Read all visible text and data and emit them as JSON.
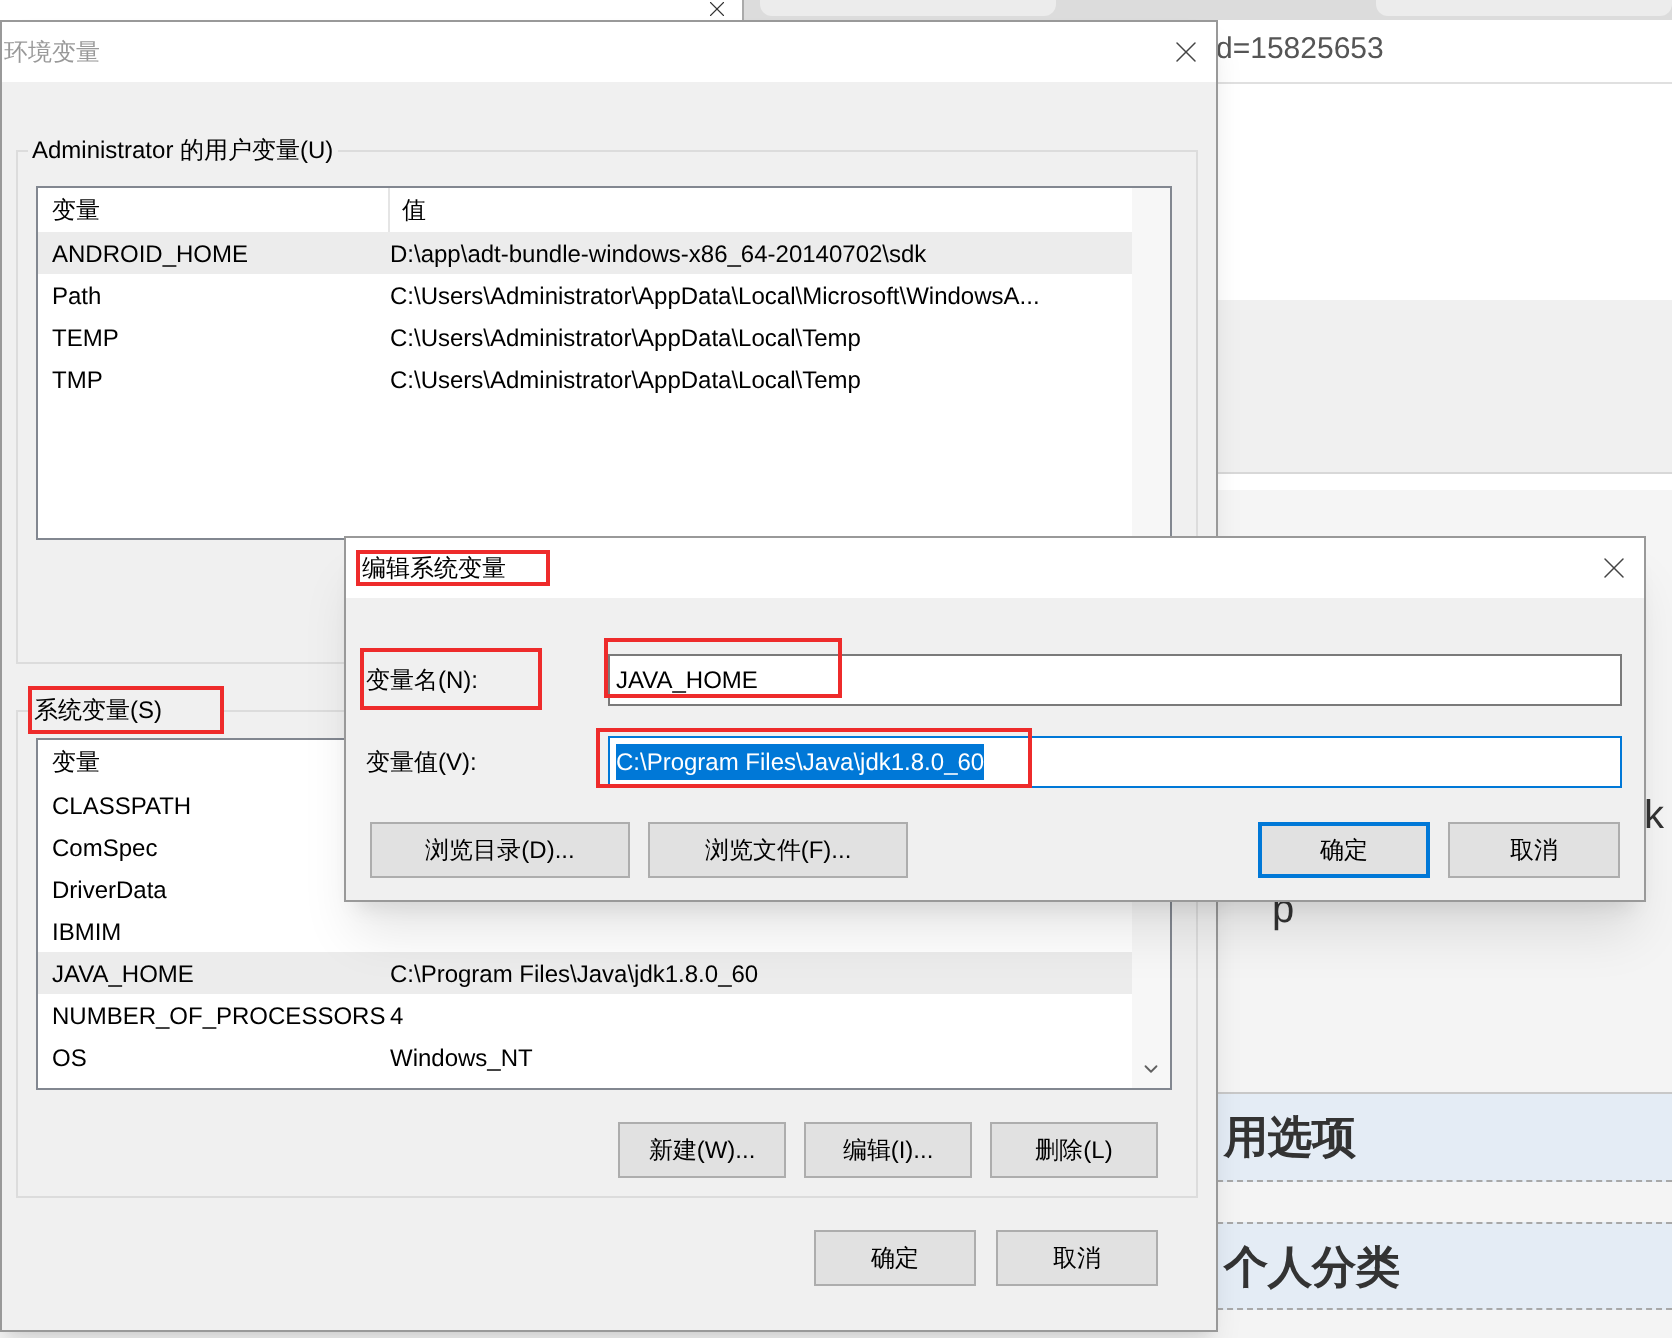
{
  "browser": {
    "address_fragment": "d=15825653",
    "fragment_1": "k",
    "fragment_2": "p",
    "sections": [
      "用选项",
      "个人分类"
    ]
  },
  "env_dialog": {
    "title": "环境变量",
    "user_group": {
      "title": "Administrator 的用户变量(U)",
      "columns": [
        "变量",
        "值"
      ],
      "rows": [
        {
          "name": "ANDROID_HOME",
          "value": "D:\\app\\adt-bundle-windows-x86_64-20140702\\sdk",
          "selected": true
        },
        {
          "name": "Path",
          "value": "C:\\Users\\Administrator\\AppData\\Local\\Microsoft\\WindowsA...",
          "selected": false
        },
        {
          "name": "TEMP",
          "value": "C:\\Users\\Administrator\\AppData\\Local\\Temp",
          "selected": false
        },
        {
          "name": "TMP",
          "value": "C:\\Users\\Administrator\\AppData\\Local\\Temp",
          "selected": false
        }
      ]
    },
    "system_group": {
      "title": "系统变量(S)",
      "columns": [
        "变量"
      ],
      "rows": [
        {
          "name": "CLASSPATH",
          "selected": false
        },
        {
          "name": "ComSpec",
          "selected": false
        },
        {
          "name": "DriverData",
          "selected": false
        },
        {
          "name": "IBMIM",
          "selected": false
        },
        {
          "name": "JAVA_HOME",
          "value": "C:\\Program Files\\Java\\jdk1.8.0_60",
          "selected": true
        },
        {
          "name": "NUMBER_OF_PROCESSORS",
          "value": "4",
          "selected": false
        },
        {
          "name": "OS",
          "value": "Windows_NT",
          "selected": false
        }
      ],
      "buttons": [
        "新建(W)...",
        "编辑(I)...",
        "删除(L)"
      ]
    },
    "buttons": [
      "确定",
      "取消"
    ]
  },
  "edit_dialog": {
    "title": "编辑系统变量",
    "name_label": "变量名(N):",
    "name_value": "JAVA_HOME",
    "value_label": "变量值(V):",
    "value_value": "C:\\Program Files\\Java\\jdk1.8.0_60",
    "value_selected": true,
    "buttons": [
      {
        "label": "浏览目录(D)...",
        "default": false
      },
      {
        "label": "浏览文件(F)...",
        "default": false
      },
      {
        "label": "确定",
        "default": true
      },
      {
        "label": "取消",
        "default": false
      }
    ]
  }
}
